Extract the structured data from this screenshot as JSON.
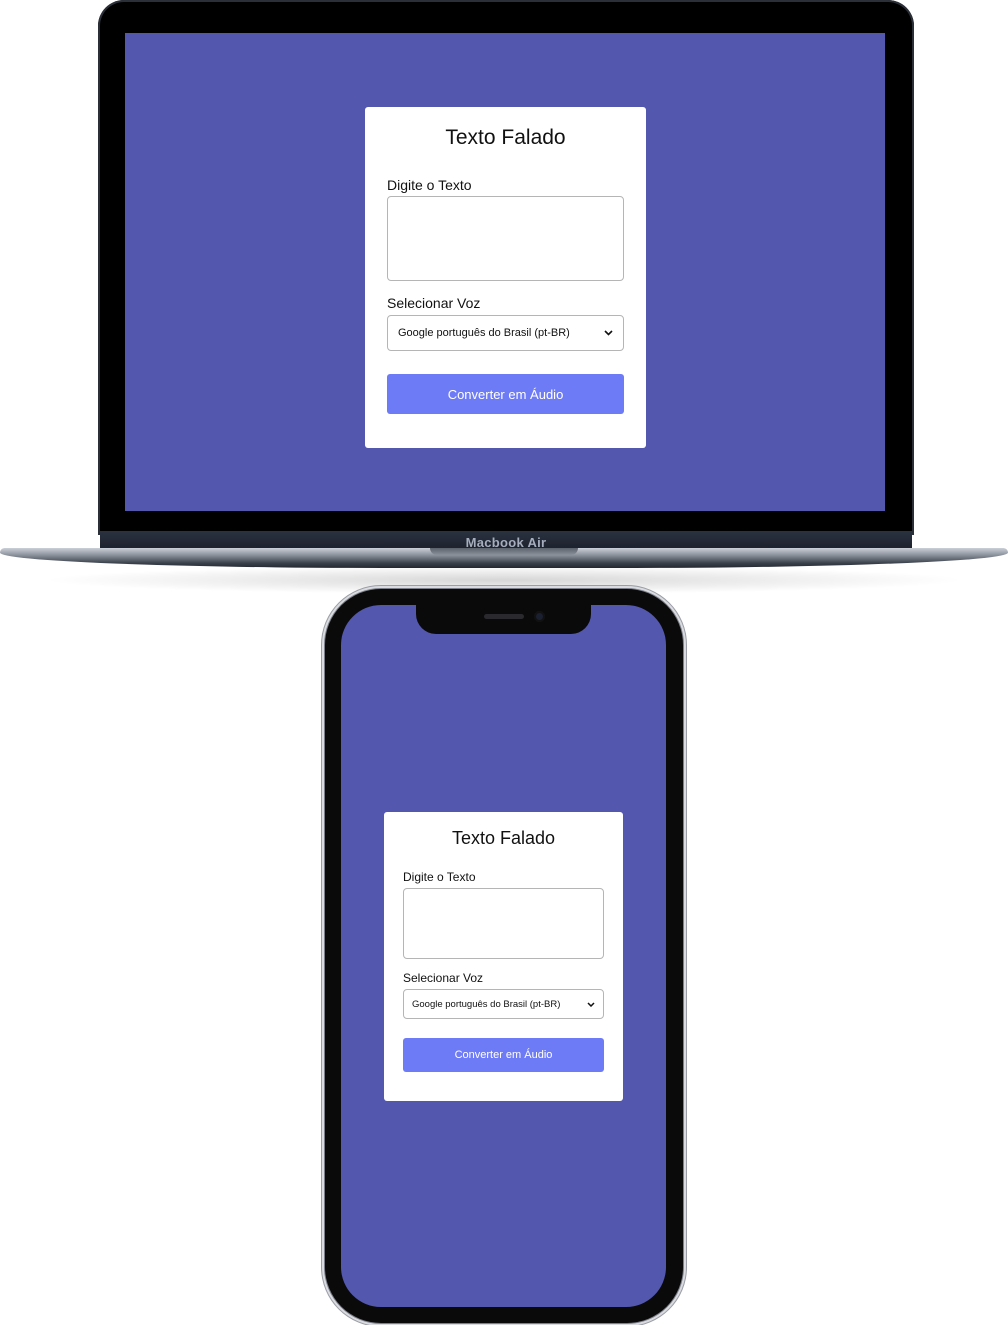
{
  "devices": {
    "laptop_label": "Macbook Air"
  },
  "app": {
    "title": "Texto Falado",
    "text_label": "Digite o Texto",
    "text_value": "",
    "voice_label": "Selecionar Voz",
    "voice_selected": "Google português do Brasil (pt-BR)",
    "convert_label": "Converter em Áudio"
  },
  "colors": {
    "background": "#5357ae",
    "card": "#ffffff",
    "button": "#6e7bf6",
    "button_text": "#ffffff"
  },
  "icons": {
    "select_arrow": "chevron-down-icon"
  }
}
